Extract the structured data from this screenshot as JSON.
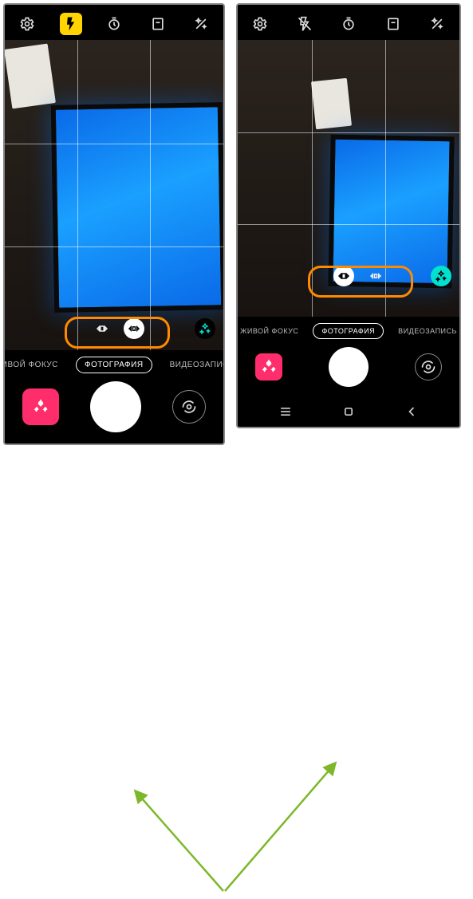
{
  "colors": {
    "flash_active_bg": "#ffd400",
    "highlight_border": "#ff8a00",
    "arrow": "#7db82a",
    "filters_teal": "#02e0d0",
    "gallery_pink": "#ff2d6b"
  },
  "phone_a": {
    "flash_state": "on",
    "top_icons": [
      "settings-gear-icon",
      "flash-icon",
      "timer-icon",
      "aspect-ratio-icon",
      "effects-icon"
    ],
    "zoom": {
      "options": [
        "wide",
        "1x"
      ],
      "selected": "1x"
    },
    "modes": {
      "items": [
        "ЖИВОЙ ФОКУС",
        "ФОТОГРАФИЯ",
        "ВИДЕОЗАПИСЬ"
      ],
      "active_index": 1
    }
  },
  "phone_b": {
    "flash_state": "off",
    "top_icons": [
      "settings-gear-icon",
      "flash-icon",
      "timer-icon",
      "aspect-ratio-icon",
      "effects-icon"
    ],
    "zoom": {
      "options": [
        "wide",
        "1x"
      ],
      "selected": "wide"
    },
    "modes": {
      "items": [
        "ЖИВОЙ ФОКУС",
        "ФОТОГРАФИЯ",
        "ВИДЕОЗАПИСЬ"
      ],
      "active_index": 1
    },
    "nav": [
      "recents",
      "home",
      "back"
    ]
  }
}
